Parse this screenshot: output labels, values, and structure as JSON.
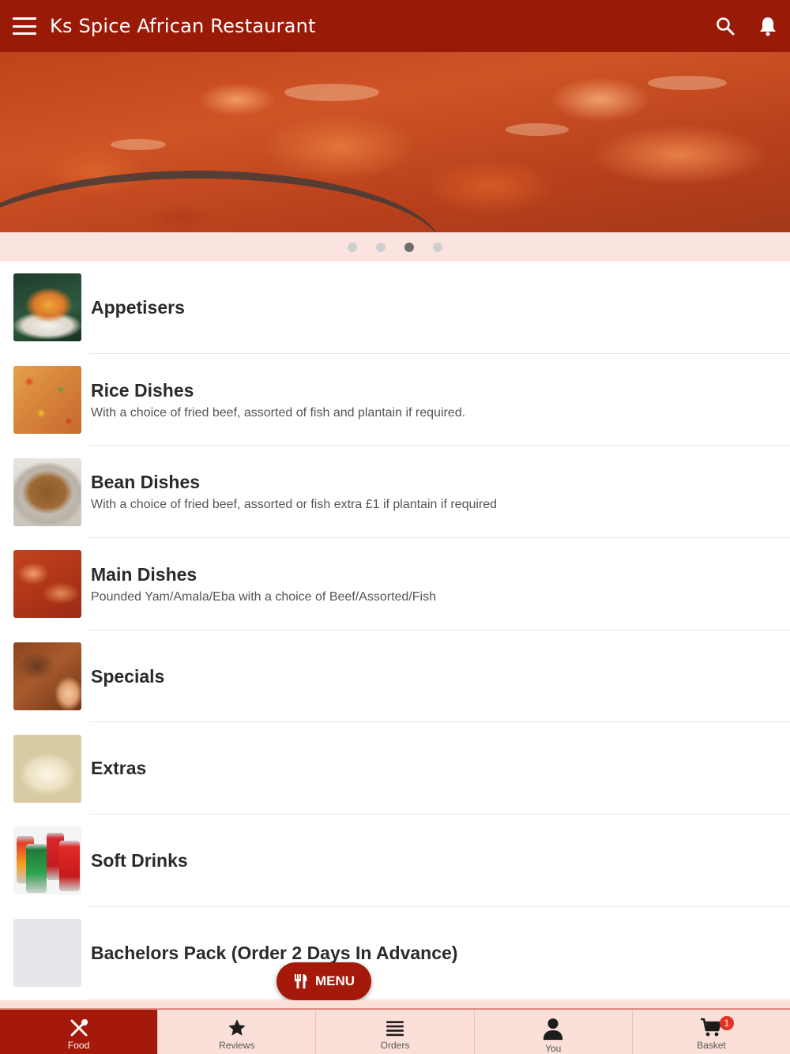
{
  "app": {
    "title": "Ks Spice African Restaurant"
  },
  "carousel": {
    "slides": 4,
    "active_index": 2
  },
  "categories": [
    {
      "title": "Appetisers",
      "description": "",
      "image": "appetisers-thumbnail"
    },
    {
      "title": "Rice Dishes",
      "description": "With a choice of fried beef, assorted of fish and plantain if required.",
      "image": "rice-dishes-thumbnail"
    },
    {
      "title": "Bean Dishes",
      "description": "With a choice of fried beef, assorted or fish extra £1 if plantain if required",
      "image": "bean-dishes-thumbnail"
    },
    {
      "title": "Main Dishes",
      "description": "Pounded Yam/Amala/Eba with a choice of Beef/Assorted/Fish",
      "image": "main-dishes-thumbnail"
    },
    {
      "title": "Specials",
      "description": "",
      "image": "specials-thumbnail"
    },
    {
      "title": "Extras",
      "description": "",
      "image": "extras-thumbnail"
    },
    {
      "title": "Soft Drinks",
      "description": "",
      "image": "soft-drinks-thumbnail"
    },
    {
      "title": "Bachelors Pack (Order 2 Days In Advance)",
      "description": "",
      "image": "placeholder-thumbnail"
    }
  ],
  "menu_button": {
    "label": "MENU",
    "icon": "fork-knife-icon"
  },
  "bottom_nav": [
    {
      "label": "Food",
      "icon": "fork-spoon-cross-icon",
      "active": true
    },
    {
      "label": "Reviews",
      "icon": "star-icon",
      "active": false
    },
    {
      "label": "Orders",
      "icon": "list-icon",
      "active": false
    },
    {
      "label": "You",
      "icon": "person-icon",
      "active": false
    },
    {
      "label": "Basket",
      "icon": "cart-icon",
      "active": false,
      "badge": "1"
    }
  ],
  "colors": {
    "brand": "#9a1a08",
    "accent_light": "#fbe0d9",
    "badge": "#e53224"
  }
}
